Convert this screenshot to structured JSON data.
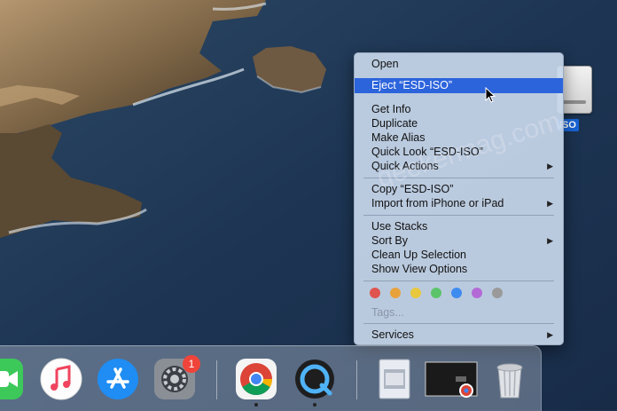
{
  "desktop": {
    "disk_label": "ISO"
  },
  "context_menu": {
    "open": "Open",
    "eject": "Eject “ESD-ISO”",
    "get_info": "Get Info",
    "duplicate": "Duplicate",
    "make_alias": "Make Alias",
    "quick_look": "Quick Look “ESD-ISO”",
    "quick_actions": "Quick Actions",
    "copy": "Copy “ESD-ISO”",
    "import_iphone": "Import from iPhone or iPad",
    "use_stacks": "Use Stacks",
    "sort_by": "Sort By",
    "clean_up": "Clean Up Selection",
    "show_view_options": "Show View Options",
    "tags": "Tags...",
    "services": "Services",
    "tag_colors": [
      "#e0544f",
      "#e8a23c",
      "#e8c83c",
      "#5bc46a",
      "#3f8cf0",
      "#b36ad6",
      "#9a9a9a"
    ]
  },
  "dock": {
    "apps": [
      "facetime",
      "music",
      "app-store",
      "system-preferences",
      "chrome",
      "quicktime",
      "preview",
      "screenshot",
      "trash"
    ],
    "notification_badge": "1"
  },
  "watermark": "geekermag.com"
}
